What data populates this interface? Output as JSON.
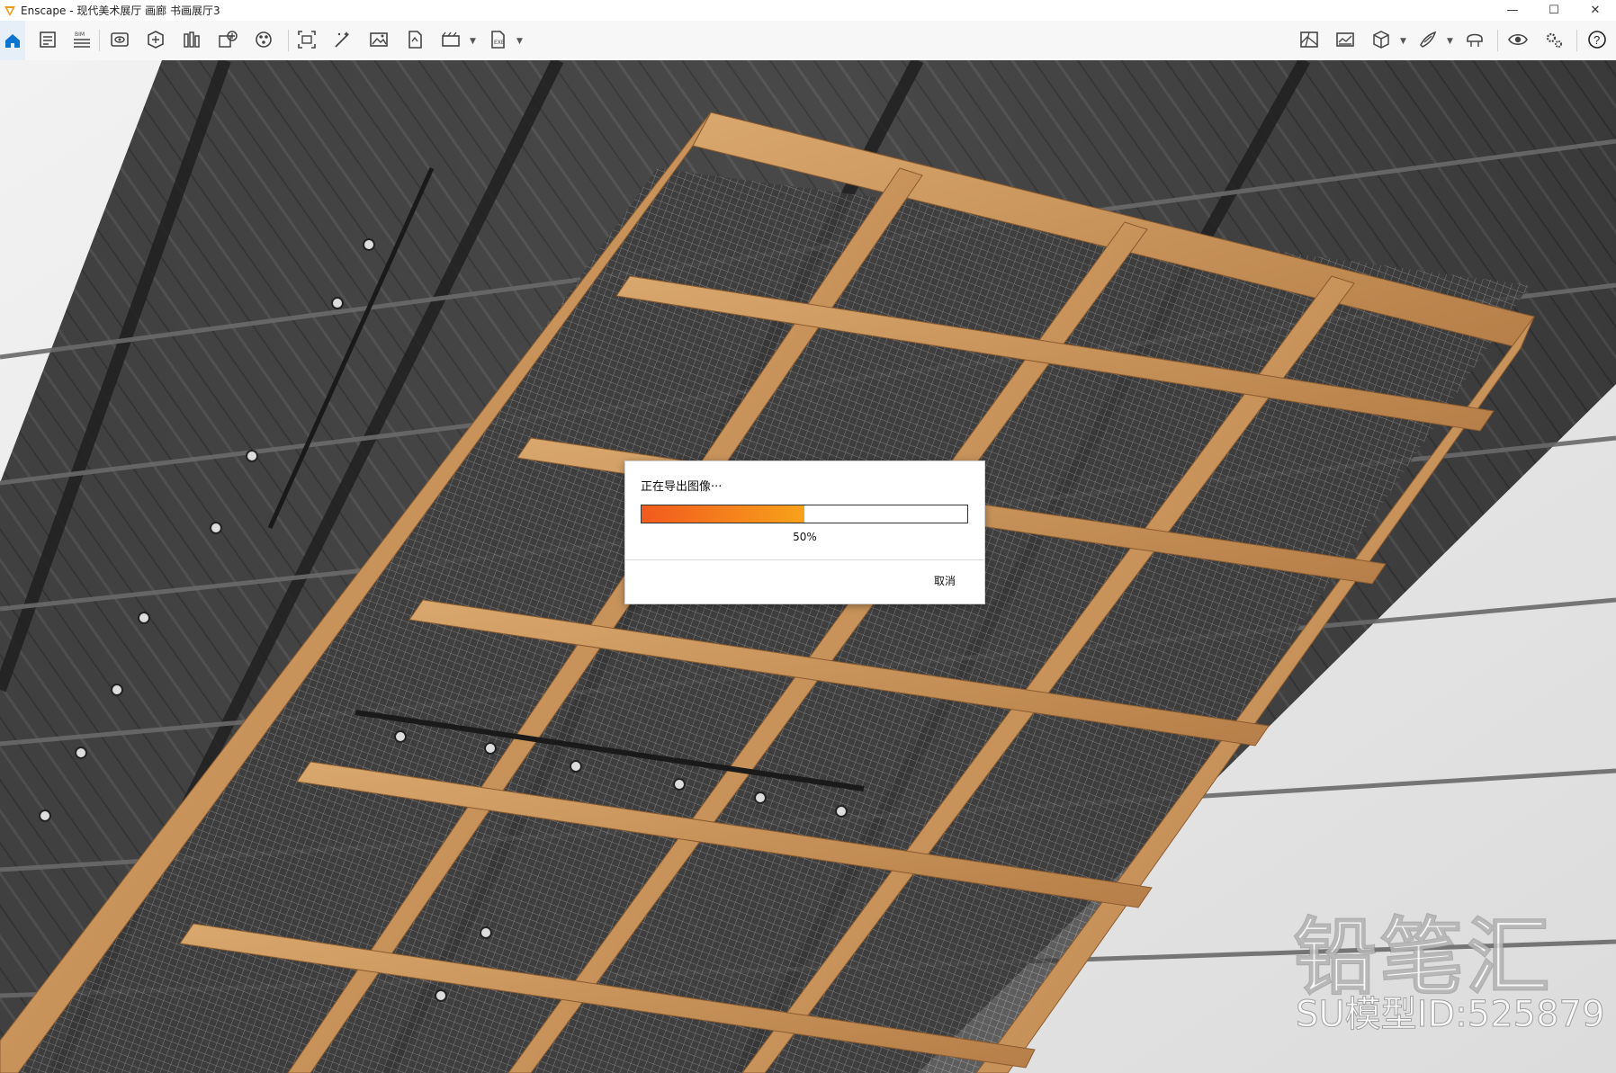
{
  "window": {
    "title": "Enscape - 现代美术展厅 画廊 书画展厅3",
    "controls": {
      "minimize": "—",
      "maximize": "☐",
      "close": "✕"
    }
  },
  "toolbar": {
    "left_icons": [
      "home-icon",
      "project-settings-icon",
      "bim-icon",
      "views-icon",
      "assets-icon",
      "library-icon",
      "add-asset-icon",
      "materials-icon",
      "screenshot-icon",
      "batch-render-icon",
      "panorama-icon",
      "export-icon",
      "video-icon",
      "exe-export-icon"
    ],
    "right_icons": [
      "mini-map-icon",
      "atmosphere-icon",
      "cube-view-icon",
      "sketch-mode-icon",
      "vr-icon",
      "visual-settings-icon",
      "general-settings-icon",
      "help-icon"
    ],
    "bim_badge": "BIM",
    "help_label": "?"
  },
  "export_dialog": {
    "title": "正在导出图像···",
    "progress": 0.5,
    "progress_label": "50%",
    "cancel_label": "取消"
  },
  "watermark": {
    "brand": "铅笔汇",
    "model_id": "SU模型ID:525879"
  },
  "colors": {
    "accent": "#0a74d1",
    "progress_start": "#f25a1e",
    "progress_end": "#f7a21a",
    "wood": "#c8915a"
  }
}
